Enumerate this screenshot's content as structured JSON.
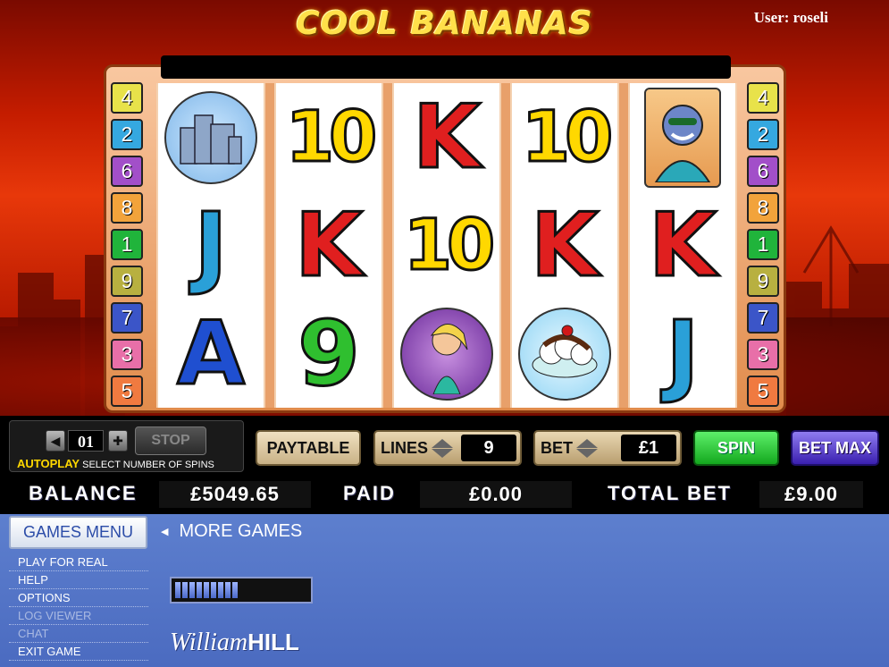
{
  "game": {
    "title": "COOL BANANAS",
    "user_label": "User: roseli"
  },
  "paylines": {
    "left": [
      "4",
      "2",
      "6",
      "8",
      "1",
      "9",
      "7",
      "3",
      "5"
    ],
    "right": [
      "4",
      "2",
      "6",
      "8",
      "1",
      "9",
      "7",
      "3",
      "5"
    ],
    "colors": [
      "#e8e24a",
      "#35a8e0",
      "#a24fc9",
      "#f2a33b",
      "#20b43b",
      "#b8b040",
      "#3b55c8",
      "#e86fa8",
      "#f07a40"
    ]
  },
  "reels": [
    [
      "city",
      "J",
      "A"
    ],
    [
      "10",
      "K",
      "9"
    ],
    [
      "K",
      "10",
      "girl"
    ],
    [
      "10",
      "K",
      "sundae"
    ],
    [
      "gorilla",
      "K",
      "J"
    ]
  ],
  "autoplay": {
    "count": "01",
    "stop_label": "STOP",
    "label_bold": "AUTOPLAY",
    "label_rest": " SELECT NUMBER OF SPINS"
  },
  "buttons": {
    "paytable": "PAYTABLE",
    "lines_label": "LINES",
    "lines_value": "9",
    "bet_label": "BET",
    "bet_value": "£1",
    "spin": "SPIN",
    "bet_max": "BET MAX"
  },
  "stats": {
    "balance_label": "BALANCE",
    "balance_value": "£5049.65",
    "paid_label": "PAID",
    "paid_value": "£0.00",
    "total_bet_label": "TOTAL BET",
    "total_bet_value": "£9.00"
  },
  "menu": {
    "games_menu": "GAMES MENU",
    "more_games": "MORE GAMES",
    "items": [
      {
        "label": "PLAY FOR REAL",
        "enabled": true
      },
      {
        "label": "HELP",
        "enabled": true
      },
      {
        "label": "OPTIONS",
        "enabled": true
      },
      {
        "label": "LOG VIEWER",
        "enabled": false
      },
      {
        "label": "CHAT",
        "enabled": false
      },
      {
        "label": "EXIT GAME",
        "enabled": true
      }
    ],
    "loading_segments": 9,
    "logo_script": "William",
    "logo_bold": "HILL"
  }
}
